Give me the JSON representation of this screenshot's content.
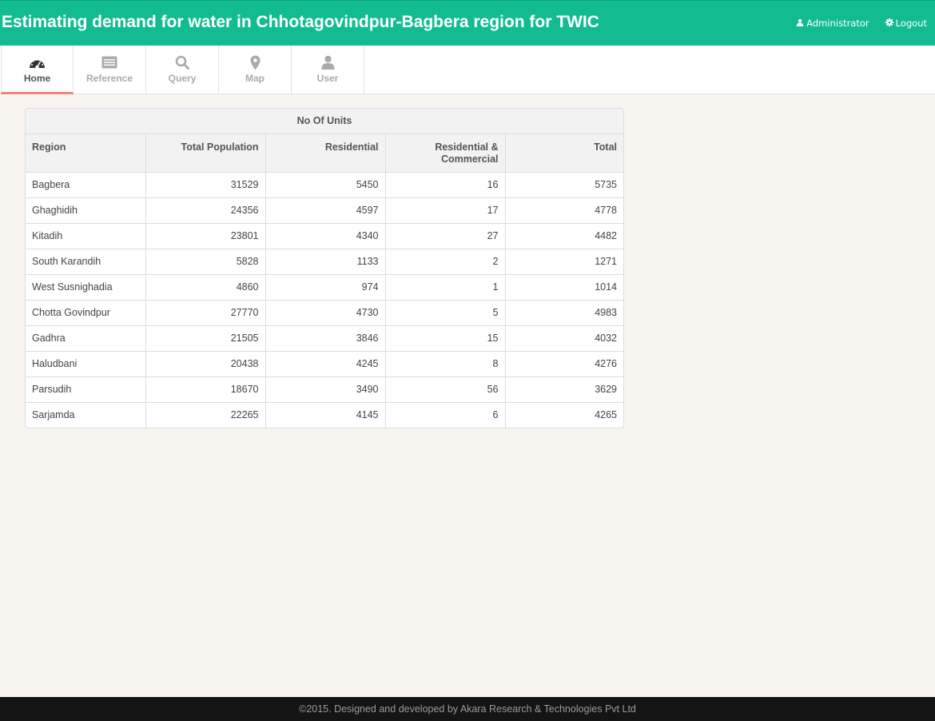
{
  "header": {
    "title": "Estimating demand for water in Chhotagovindpur-Bagbera region for TWIC",
    "user_label": "Administrator",
    "user_icon": "user-icon",
    "logout_label": "Logout",
    "logout_icon": "gear-icon"
  },
  "tabs": [
    {
      "label": "Home",
      "icon": "dashboard-icon",
      "active": true
    },
    {
      "label": "Reference",
      "icon": "list-icon",
      "active": false
    },
    {
      "label": "Query",
      "icon": "search-icon",
      "active": false
    },
    {
      "label": "Map",
      "icon": "map-marker-icon",
      "active": false
    },
    {
      "label": "User",
      "icon": "user-icon",
      "active": false
    }
  ],
  "table": {
    "group_header": "No Of Units",
    "columns": [
      "Region",
      "Total Population",
      "Residential",
      "Residential & Commercial",
      "Total"
    ],
    "rows": [
      [
        "Bagbera",
        "31529",
        "5450",
        "16",
        "5735"
      ],
      [
        "Ghaghidih",
        "24356",
        "4597",
        "17",
        "4778"
      ],
      [
        "Kitadih",
        "23801",
        "4340",
        "27",
        "4482"
      ],
      [
        "South Karandih",
        "5828",
        "1133",
        "2",
        "1271"
      ],
      [
        "West Susnighadia",
        "4860",
        "974",
        "1",
        "1014"
      ],
      [
        "Chotta Govindpur",
        "27770",
        "4730",
        "5",
        "4983"
      ],
      [
        "Gadhra",
        "21505",
        "3846",
        "15",
        "4032"
      ],
      [
        "Haludbani",
        "20438",
        "4245",
        "8",
        "4276"
      ],
      [
        "Parsudih",
        "18670",
        "3490",
        "56",
        "3629"
      ],
      [
        "Sarjamda",
        "22265",
        "4145",
        "6",
        "4265"
      ]
    ]
  },
  "footer": {
    "text": "©2015. Designed and developed by Akara Research & Technologies Pvt Ltd"
  },
  "colors": {
    "header_bg": "#12bc90",
    "active_tab_underline": "#f0857c",
    "page_bg": "#f8f5f0",
    "footer_bg": "#141414"
  }
}
